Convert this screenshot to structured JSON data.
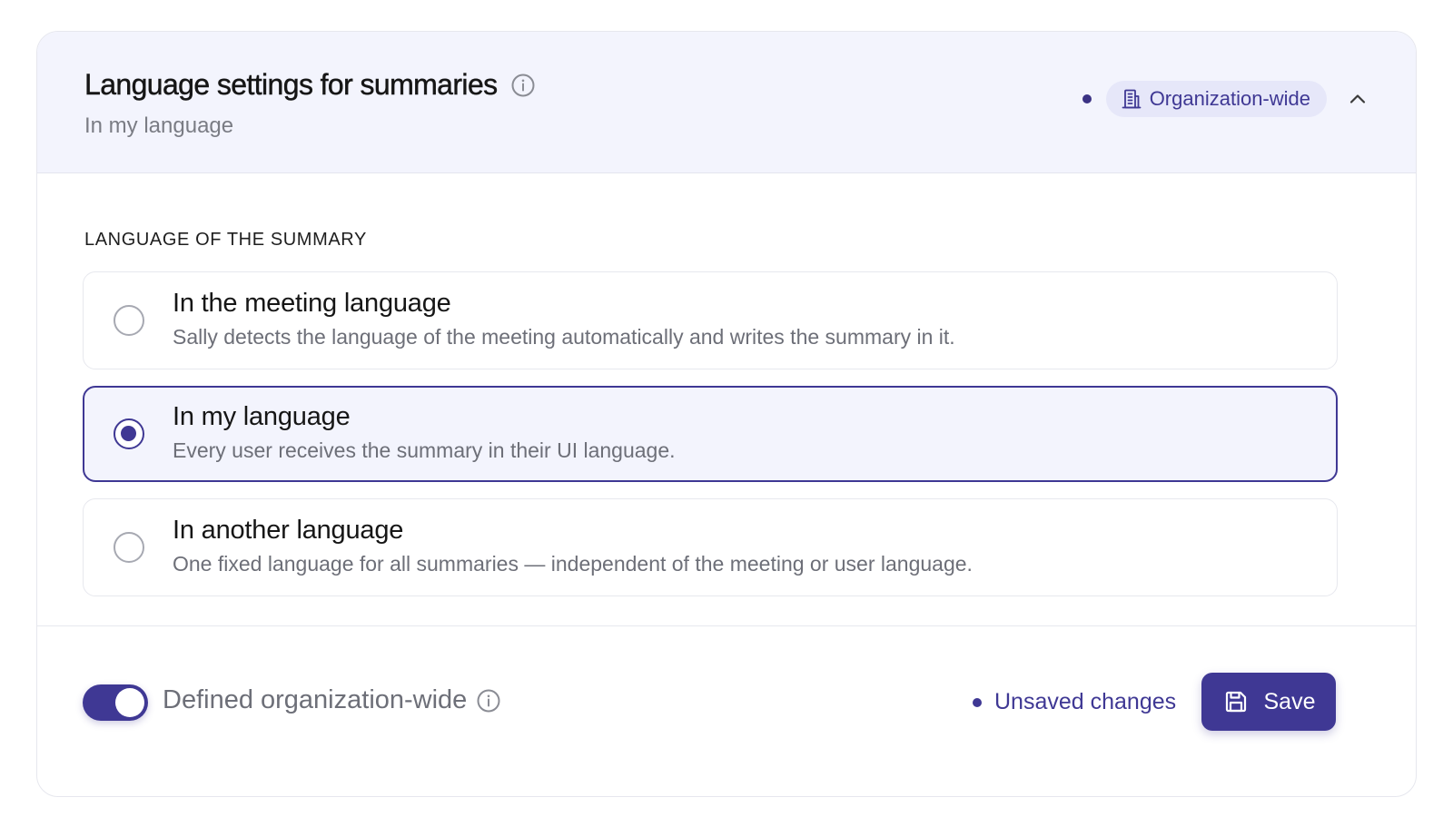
{
  "header": {
    "title": "Language settings for summaries",
    "subtitle": "In my language",
    "badge_label": "Organization-wide",
    "icons": [
      "info-icon",
      "building-icon",
      "chevron-up-icon"
    ]
  },
  "section": {
    "label": "LANGUAGE OF THE SUMMARY"
  },
  "options": [
    {
      "title": "In the meeting language",
      "description": "Sally detects the language of the meeting automatically and writes the summary in it.",
      "selected": false
    },
    {
      "title": "In my language",
      "description": "Every user receives the summary in their UI language.",
      "selected": true
    },
    {
      "title": "In another language",
      "description": "One fixed language for all summaries — independent of the meeting or user language.",
      "selected": false
    }
  ],
  "footer": {
    "toggle_on": true,
    "toggle_label": "Defined organization-wide",
    "unsaved_label": "Unsaved changes",
    "save_label": "Save",
    "icons": [
      "info-icon",
      "save-icon"
    ]
  },
  "colors": {
    "accent": "#3f3894",
    "header_bg": "#f3f4fd",
    "badge_bg": "#e6e7f9",
    "muted_text": "#6d6f78",
    "border": "#e7e8ee"
  }
}
